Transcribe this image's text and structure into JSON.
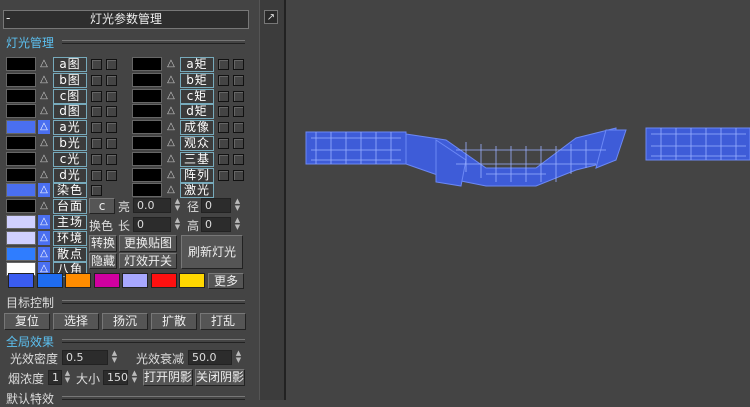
{
  "panel": {
    "collapse_symbol": "-",
    "title": "灯光参数管理",
    "corner_icon": "↗",
    "section_light": "灯光管理",
    "left_rows": [
      {
        "label": "a图",
        "active": false,
        "swatch": "#000000"
      },
      {
        "label": "b图",
        "active": false,
        "swatch": "#000000"
      },
      {
        "label": "c图",
        "active": false,
        "swatch": "#000000"
      },
      {
        "label": "d图",
        "active": false,
        "swatch": "#000000"
      },
      {
        "label": "a光",
        "active": true,
        "swatch": "#4a6ff0"
      },
      {
        "label": "b光",
        "active": false,
        "swatch": "#000000"
      },
      {
        "label": "c光",
        "active": false,
        "swatch": "#000000"
      },
      {
        "label": "d光",
        "active": false,
        "swatch": "#000000"
      },
      {
        "label": "染色",
        "active": true,
        "swatch": "#4a6ff0"
      },
      {
        "label": "台面",
        "active": false,
        "swatch": "#000000"
      },
      {
        "label": "主场",
        "active": true,
        "swatch": "#d0d0ff"
      },
      {
        "label": "环境",
        "active": true,
        "swatch": "#d0d0ff"
      },
      {
        "label": "散点",
        "active": true,
        "swatch": "#2f7dff"
      },
      {
        "label": "八角",
        "active": true,
        "swatch": "#ffffff"
      }
    ],
    "right_rows": [
      {
        "label": "a矩"
      },
      {
        "label": "b矩"
      },
      {
        "label": "c矩"
      },
      {
        "label": "d矩"
      },
      {
        "label": "成像"
      },
      {
        "label": "观众"
      },
      {
        "label": "三基"
      },
      {
        "label": "阵列"
      },
      {
        "label": "激光"
      }
    ],
    "small_c_button": "c",
    "bright_label": "亮",
    "bright_value": "0.0",
    "radius_label": "径",
    "radius_value": "0",
    "change_color_label": "换色",
    "length_label": "长",
    "length_value": "0",
    "height_label": "高",
    "height_value": "0",
    "convert_button": "转换",
    "replace_map_button": "更换贴图",
    "refresh_button": "刷新灯光",
    "hide_button": "隐藏",
    "light_switch_button": "灯效开关",
    "colors": [
      "#3a5cf0",
      "#1f6cf0",
      "#ff8c00",
      "#d000a0",
      "#a8a8ff",
      "#ff1010",
      "#ffd700"
    ],
    "more_button": "更多",
    "section_target": "目标控制",
    "target_buttons": [
      "复位",
      "选择",
      "扬沉",
      "扩散",
      "打乱"
    ],
    "section_global": "全局效果",
    "density_label": "光效密度",
    "density_value": "0.5",
    "decay_label": "光效衰减",
    "decay_value": "50.0",
    "smoke_label": "烟浓度",
    "smoke_value": "1",
    "size_label": "大小",
    "size_value": "150",
    "shadow_on_button": "打开阴影",
    "shadow_off_button": "关闭阴影",
    "section_default": "默认特效"
  },
  "viewport": {
    "background": "#444444",
    "model_color": "#4a6ff0"
  }
}
